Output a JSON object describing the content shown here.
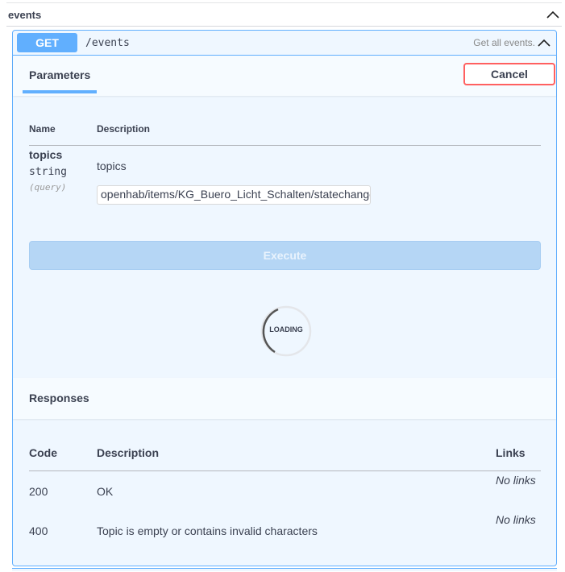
{
  "tag": {
    "title": "events"
  },
  "operation": {
    "method": "GET",
    "path": "/events",
    "summary": "Get all events."
  },
  "parameters": {
    "tab_label": "Parameters",
    "cancel_label": "Cancel",
    "columns": {
      "name": "Name",
      "description": "Description"
    },
    "items": [
      {
        "name": "topics",
        "type": "string",
        "in": "(query)",
        "description": "topics",
        "value": "openhab/items/KG_Buero_Licht_Schalten/statechanged"
      }
    ],
    "execute_label": "Execute",
    "loading_label": "LOADING"
  },
  "responses": {
    "title": "Responses",
    "columns": {
      "code": "Code",
      "description": "Description",
      "links": "Links"
    },
    "rows": [
      {
        "code": "200",
        "description": "OK",
        "links": "No links"
      },
      {
        "code": "400",
        "description": "Topic is empty or contains invalid characters",
        "links": "No links"
      }
    ]
  },
  "colors": {
    "get_accent": "#61affe",
    "opblock_bg": "#eff7ff",
    "cancel_border": "#ff6060",
    "execute_disabled": "#b5d6f5"
  },
  "icons": {
    "collapse": "chevron-up-icon",
    "spinner": "loading-spinner"
  }
}
